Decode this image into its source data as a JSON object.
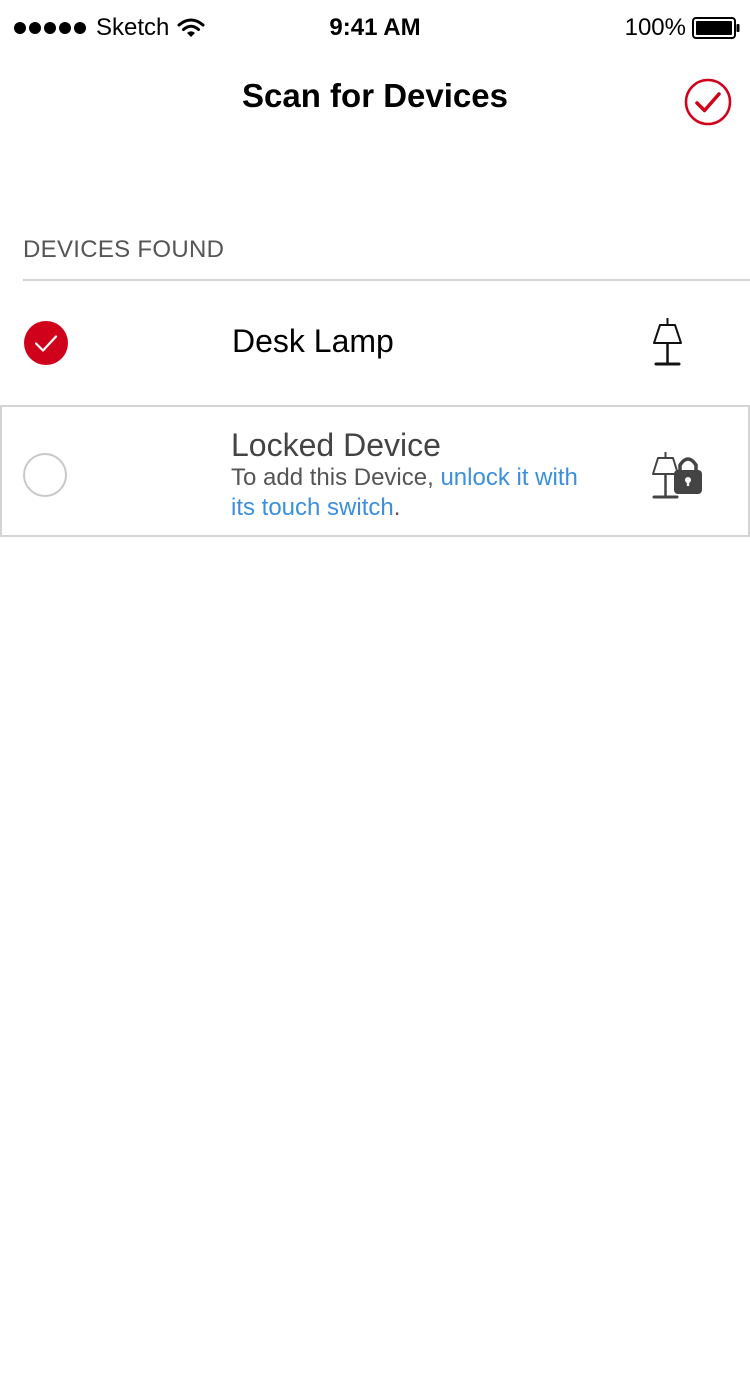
{
  "status_bar": {
    "carrier": "Sketch",
    "time": "9:41 AM",
    "battery": "100%"
  },
  "nav": {
    "title": "Scan for Devices",
    "done_icon": "checkmark-circle-icon"
  },
  "section": {
    "header": "DEVICES FOUND"
  },
  "devices": [
    {
      "name": "Desk Lamp",
      "selected": true,
      "icon": "lamp-icon"
    },
    {
      "name": "Locked Device",
      "selected": false,
      "icon": "lamp-lock-icon",
      "hint_prefix": "To add this Device, ",
      "hint_link": "unlock it with its touch switch",
      "hint_suffix": "."
    }
  ],
  "colors": {
    "accent": "#d0021b",
    "link": "#3b8fdd",
    "divider": "#d4d4d4",
    "text_secondary": "#555555"
  }
}
